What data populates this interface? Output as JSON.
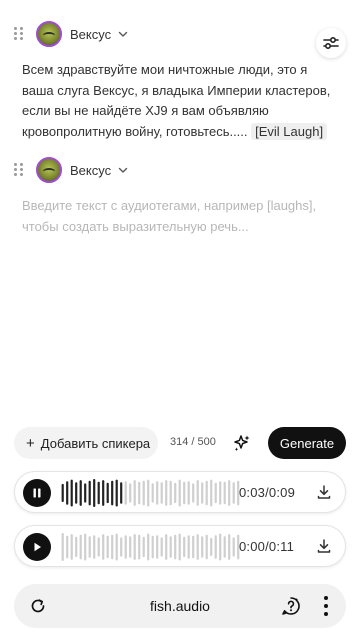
{
  "speakers": [
    {
      "name": "Вексус",
      "text_before_tag": "Всем здравствуйте мои ничтожные люди, это я ваша слуга Вексус, я владыка Империи кластеров, если вы не найдёте XJ9 я вам объявляю кровопролитную войну, готовьтесь..... ",
      "tag": "[Evil Laugh]"
    },
    {
      "name": "Вексус",
      "placeholder": "Введите текст с аудиотегами, например [laughs], чтобы создать выразительную речь..."
    }
  ],
  "toolbar": {
    "add_speaker_label": "Добавить спикера",
    "char_count": "314 / 500",
    "generate_label": "Generate"
  },
  "players": [
    {
      "state": "playing",
      "time": "0:03/0:09",
      "progress": 0.33
    },
    {
      "state": "paused",
      "time": "0:00/0:11",
      "progress": 0.0
    }
  ],
  "browser": {
    "url": "fish.audio"
  },
  "colors": {
    "accent": "#111111",
    "avatar_ring": "#a14bd1",
    "played_wave": "#222222",
    "unplayed_wave": "#cfcfcf"
  },
  "icons": [
    "drag-handle-icon",
    "chevron-down-icon",
    "sliders-icon",
    "sparkle-icon",
    "pause-icon",
    "play-icon",
    "download-icon",
    "refresh-icon",
    "help-icon",
    "more-vertical-icon"
  ]
}
